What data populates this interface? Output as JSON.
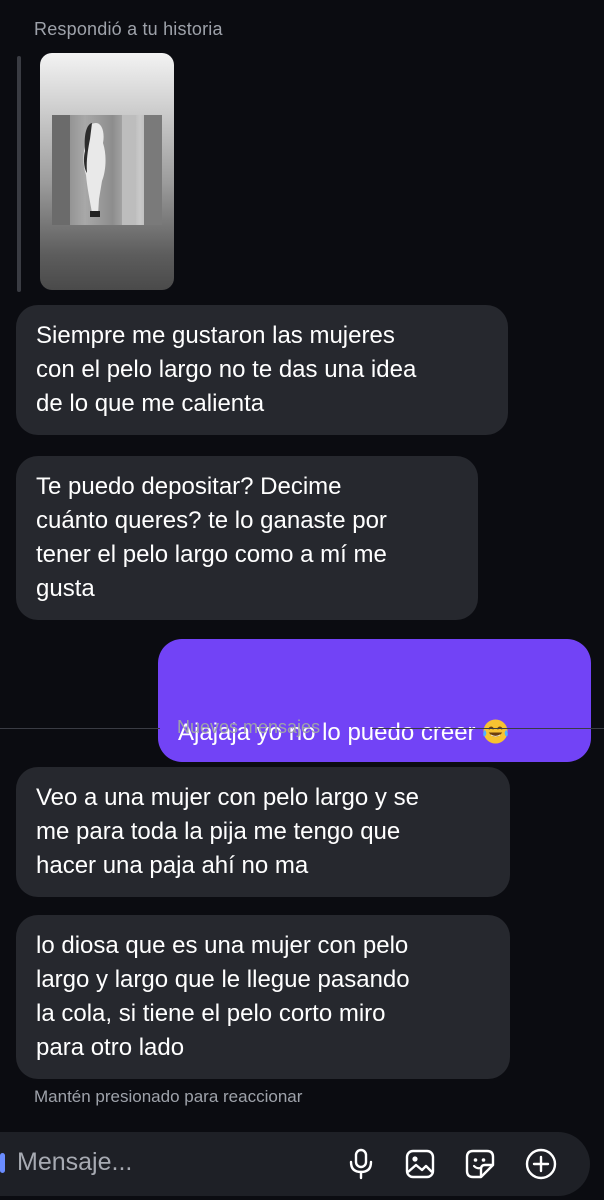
{
  "story": {
    "caption": "Respondió a tu historia"
  },
  "messages": [
    {
      "direction": "in",
      "text": "Siempre me gustaron las mujeres\ncon el pelo largo no te das una idea\nde lo que me calienta"
    },
    {
      "direction": "in",
      "text": "Te puedo depositar? Decime\ncuánto queres? te lo ganaste por\ntener el pelo largo como a mí me\ngusta"
    },
    {
      "direction": "out",
      "text": "Ajajaja yo no lo puedo creer",
      "emoji": "face-with-tears-of-joy"
    },
    {
      "direction": "in",
      "text": "Veo a una mujer con pelo largo y se\nme para toda la pija me tengo que\nhacer una paja ahí no ma"
    },
    {
      "direction": "in",
      "text": "lo diosa que es una mujer con pelo\nlargo  y largo que le llegue pasando\nla cola, si tiene el pelo corto miro\npara otro lado"
    }
  ],
  "divider": {
    "label": "Nuevos mensajes"
  },
  "hint": "Mantén presionado para reaccionar",
  "composer": {
    "placeholder": "Mensaje...",
    "icons": [
      "microphone-icon",
      "gallery-icon",
      "sticker-icon",
      "add-icon"
    ]
  },
  "colors": {
    "background": "#0b0c11",
    "incoming_bubble": "#26282e",
    "outgoing_bubble": "#7243f6",
    "secondary_text": "#9ea2aa"
  }
}
